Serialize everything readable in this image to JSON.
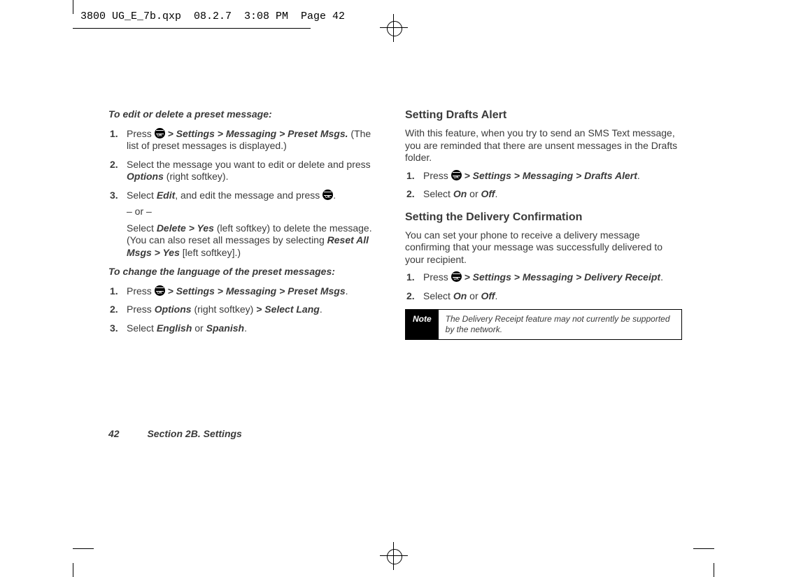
{
  "header_slug": "3800 UG_E_7b.qxp  08.2.7  3:08 PM  Page 42",
  "left": {
    "intro1": "To edit or delete a preset message:",
    "s1_a": "Press ",
    "s1_b": " > Settings > Messaging > Preset Msgs.",
    "s1_c": " (The list of preset messages is displayed.)",
    "s2_a": "Select the message you want to edit or delete and press ",
    "s2_b": "Options",
    "s2_c": " (right softkey).",
    "s3_a": "Select ",
    "s3_b": "Edit",
    "s3_c": ", and edit the message and press ",
    "s3_d": ".",
    "or": "– or –",
    "s3_e": "Select ",
    "s3_f": "Delete > Yes",
    "s3_g": " (left softkey) to delete the message. (You can also reset all messages by selecting ",
    "s3_h": "Reset All Msgs > Yes",
    "s3_i": " [left softkey].)",
    "intro2": "To change the language of the preset messages:",
    "t1_a": "Press ",
    "t1_b": " > Settings > Messaging > Preset Msgs",
    "t1_c": ".",
    "t2_a": "Press ",
    "t2_b": "Options",
    "t2_c": " (right softkey) ",
    "t2_d": "> Select Lang",
    "t2_e": ".",
    "t3_a": "Select ",
    "t3_b": "English",
    "t3_c": " or ",
    "t3_d": "Spanish",
    "t3_e": "."
  },
  "right": {
    "h1": "Setting Drafts Alert",
    "p1": "With this feature, when you try to send an SMS Text message, you are reminded that there are unsent messages in the Drafts folder.",
    "d1_a": "Press ",
    "d1_b": " > Settings > Messaging > Drafts Alert",
    "d1_c": ".",
    "d2_a": "Select ",
    "d2_b": "On",
    "d2_c": " or ",
    "d2_d": "Off",
    "d2_e": ".",
    "h2": "Setting the Delivery Confirmation",
    "p2": "You can set your phone to receive a delivery message confirming that your message was successfully delivered to your recipient.",
    "c1_a": "Press ",
    "c1_b": " > Settings > Messaging > Delivery Receipt",
    "c1_c": ".",
    "c2_a": "Select ",
    "c2_b": "On",
    "c2_c": " or ",
    "c2_d": "Off",
    "c2_e": ".",
    "note_label": "Note",
    "note_text": "The Delivery Receipt feature may not currently be supported by the network."
  },
  "footer": {
    "page": "42",
    "section": "Section 2B. Settings"
  }
}
